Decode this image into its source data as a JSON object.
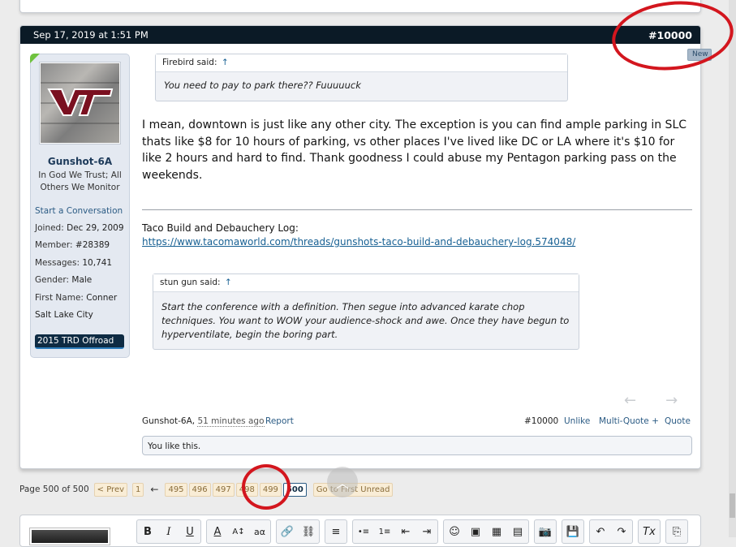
{
  "post": {
    "date": "Sep 17, 2019 at 1:51 PM",
    "number": "#10000",
    "new_tab": "New"
  },
  "user": {
    "username": "Gunshot-6A",
    "title": "In God We Trust; All Others We Monitor",
    "start_conversation": "Start a Conversation",
    "stats": [
      {
        "label": "Joined:",
        "value": "Dec 29, 2009"
      },
      {
        "label": "Member:",
        "value": "#28389"
      },
      {
        "label": "Messages:",
        "value": "10,741"
      },
      {
        "label": "Gender:",
        "value": "Male"
      },
      {
        "label": "First Name:",
        "value": "Conner"
      }
    ],
    "location": "Salt Lake City",
    "vehicle": "2015 TRD Offroad",
    "avatar_text": "VT"
  },
  "quote1": {
    "author": "Firebird said:",
    "arrow": "↑",
    "text": "You need to pay to park there?? Fuuuuuck"
  },
  "message": "I mean, downtown is just like any other city. The exception is you can find ample parking in SLC thats like $8 for 10 hours of parking, vs other places I've lived like DC or LA where it's $10 for like 2 hours and hard to find. Thank goodness I could abuse my Pentagon parking pass on the weekends.",
  "signature": {
    "title": "Taco Build and Debauchery Log:",
    "link": "https://www.tacomaworld.com/threads/gunshots-taco-build-and-debauchery-log.574048/"
  },
  "quote2": {
    "author": "stun gun said:",
    "arrow": "↑",
    "text": "Start the conference with a definition. Then segue into advanced karate chop techniques. You want to WOW your audience-shock and awe. Once they have begun to hyperventilate, begin the boring part."
  },
  "nav_arrows": {
    "prev": "←",
    "next": "→"
  },
  "footer": {
    "author": "Gunshot-6A,",
    "time": "51 minutes ago",
    "report": "Report",
    "number": "#10000",
    "unlike": "Unlike",
    "multiquote": "Multi-Quote +",
    "quote": "Quote"
  },
  "likes": "You like this.",
  "pagination": {
    "summary": "Page 500 of 500",
    "prev": "< Prev",
    "first": "1",
    "arrow": "←",
    "pages": [
      "495",
      "496",
      "497",
      "498",
      "499"
    ],
    "current": "500",
    "go_first_unread": "Go to First Unread"
  },
  "scroll_top": "︿",
  "toolbar": [
    [
      "B",
      "I",
      "U"
    ],
    [
      "A",
      "A↕",
      "aα"
    ],
    [
      "🔗",
      "⛓"
    ],
    [
      "≡"
    ],
    [
      "•≡",
      "1≡",
      "⇤",
      "⇥"
    ],
    [
      "☺",
      "▣",
      "▦",
      "▤"
    ],
    [
      "📷"
    ],
    [
      "💾"
    ],
    [
      "↶",
      "↷"
    ],
    [
      "Tx"
    ],
    [
      "⎘"
    ]
  ],
  "colors": {
    "header_bg": "#0b1a26",
    "link": "#176093",
    "annotation": "#d3161e",
    "panel_bg": "#e4e9f1"
  }
}
